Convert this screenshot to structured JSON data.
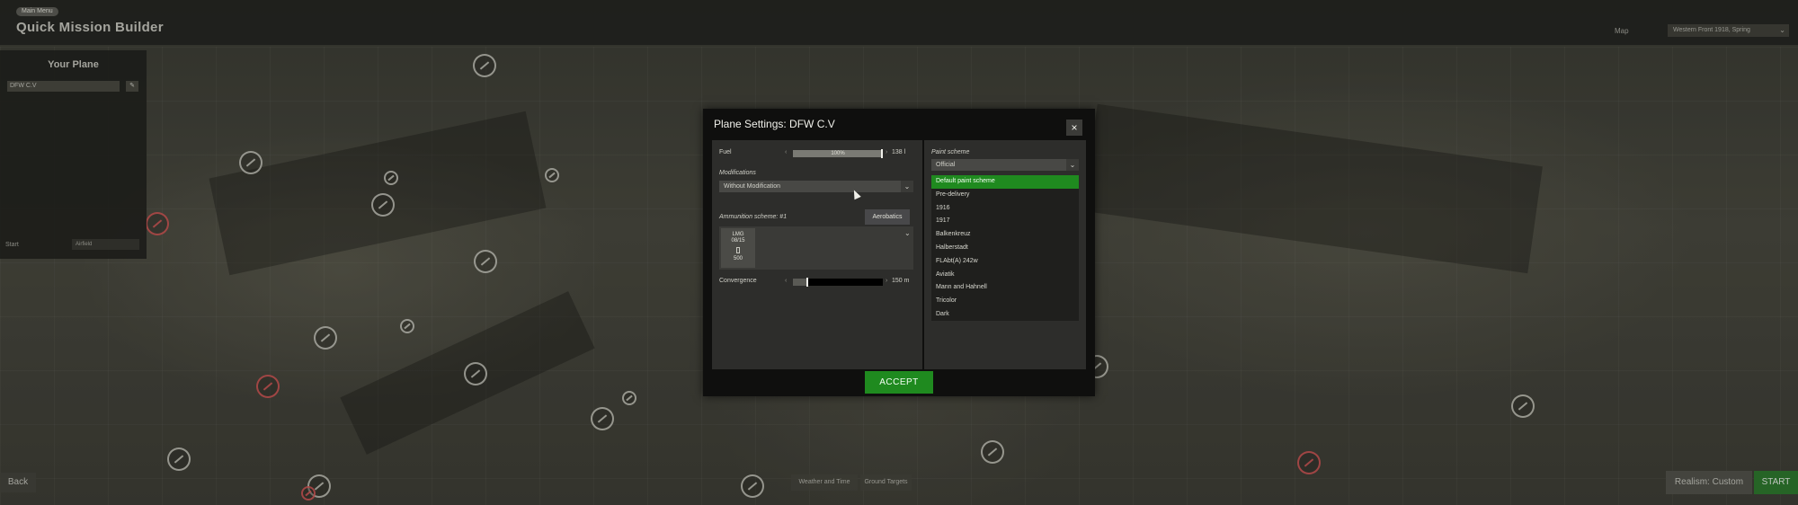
{
  "header": {
    "breadcrumb": "Main Menu",
    "title": "Quick Mission Builder",
    "map_label": "Map",
    "map_value": "Western Front 1918, Spring"
  },
  "your_plane": {
    "title": "Your Plane",
    "plane": "DFW C.V",
    "start_label": "Start",
    "start_value": "Airfield"
  },
  "bottom": {
    "back": "Back",
    "tabs": [
      "Weather and Time",
      "Ground Targets"
    ],
    "realism": "Realism: Custom",
    "start": "START"
  },
  "modal": {
    "title": "Plane Settings: DFW C.V",
    "close": "×",
    "fuel": {
      "label": "Fuel",
      "percent_text": "100%",
      "value": "138 l",
      "fraction": 0.98
    },
    "modifications": {
      "label": "Modifications",
      "selected": "Without Modification"
    },
    "ammunition": {
      "label": "Ammunition scheme: #1",
      "aerobatics": "Aerobatics",
      "weapon_line1": "LMG",
      "weapon_line2": "08/15",
      "rounds": "500"
    },
    "convergence": {
      "label": "Convergence",
      "value": "150 m",
      "fraction": 0.15
    },
    "paint": {
      "label": "Paint scheme",
      "selected": "Official",
      "options": [
        "Default paint scheme",
        "Pre-delivery",
        "1916",
        "1917",
        "Balkenkreuz",
        "Halberstadt",
        "FLAbt(A) 242w",
        "Aviatik",
        "Mann and Hahnell",
        "Tricolor",
        "Dark"
      ],
      "selected_index": 0
    },
    "accept": "ACCEPT"
  }
}
